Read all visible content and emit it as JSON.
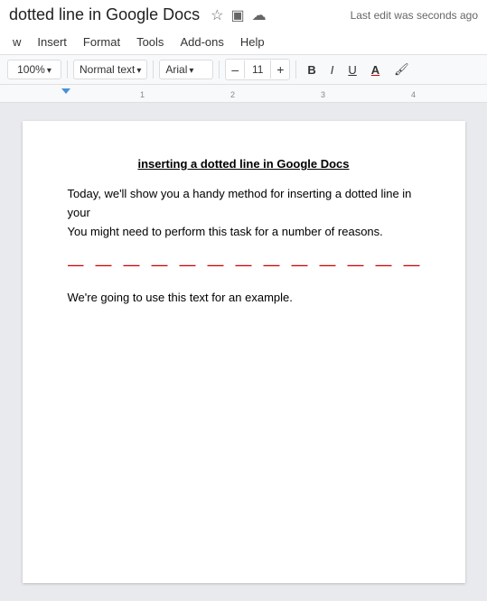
{
  "title_bar": {
    "doc_title": "dotted line in Google Docs",
    "star_icon": "★",
    "folder_icon": "🗁",
    "cloud_icon": "☁",
    "last_edit": "Last edit was seconds ago"
  },
  "menu_bar": {
    "items": [
      "w",
      "Insert",
      "Format",
      "Tools",
      "Add-ons",
      "Help"
    ]
  },
  "toolbar": {
    "zoom": "100%",
    "style": "Normal text",
    "font": "Arial",
    "font_size": "11",
    "minus_label": "–",
    "plus_label": "+",
    "bold_label": "B",
    "italic_label": "I",
    "underline_label": "U",
    "font_color_label": "A",
    "highlight_label": "🖌"
  },
  "document": {
    "heading": "inserting a dotted line in Google Docs",
    "para1": "Today, we'll show you a handy method for inserting a dotted line in your",
    "para1b": "You might need to perform this task for a number of reasons.",
    "dotted_line": "— — — — — — — — — — — — — —",
    "para2": "We're going to use this text for an example."
  }
}
